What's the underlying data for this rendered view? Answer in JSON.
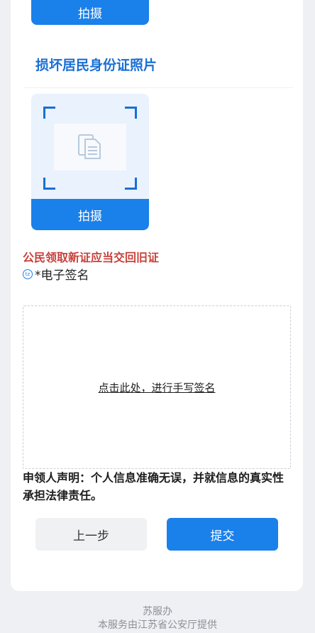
{
  "top_photo": {
    "shoot_label": "拍摄"
  },
  "damaged_photo": {
    "title": "损坏居民身份证照片",
    "shoot_label": "拍摄",
    "placeholder_icon": "document-icon"
  },
  "notice": {
    "warning": "公民领取新证应当交回旧证"
  },
  "signature": {
    "badge": "tz",
    "label": "*电子签名",
    "prompt": "点击此处，进行手写签名"
  },
  "declaration": "申领人声明：个人信息准确无误，并就信息的真实性承担法律责任。",
  "actions": {
    "prev_label": "上一步",
    "submit_label": "提交"
  },
  "footer": {
    "brand": "苏服办",
    "provider": "本服务由江苏省公安厅提供"
  },
  "colors": {
    "primary": "#1a80ea",
    "title": "#1a6fd3",
    "warning": "#c8413b",
    "background": "#eef0f3"
  }
}
